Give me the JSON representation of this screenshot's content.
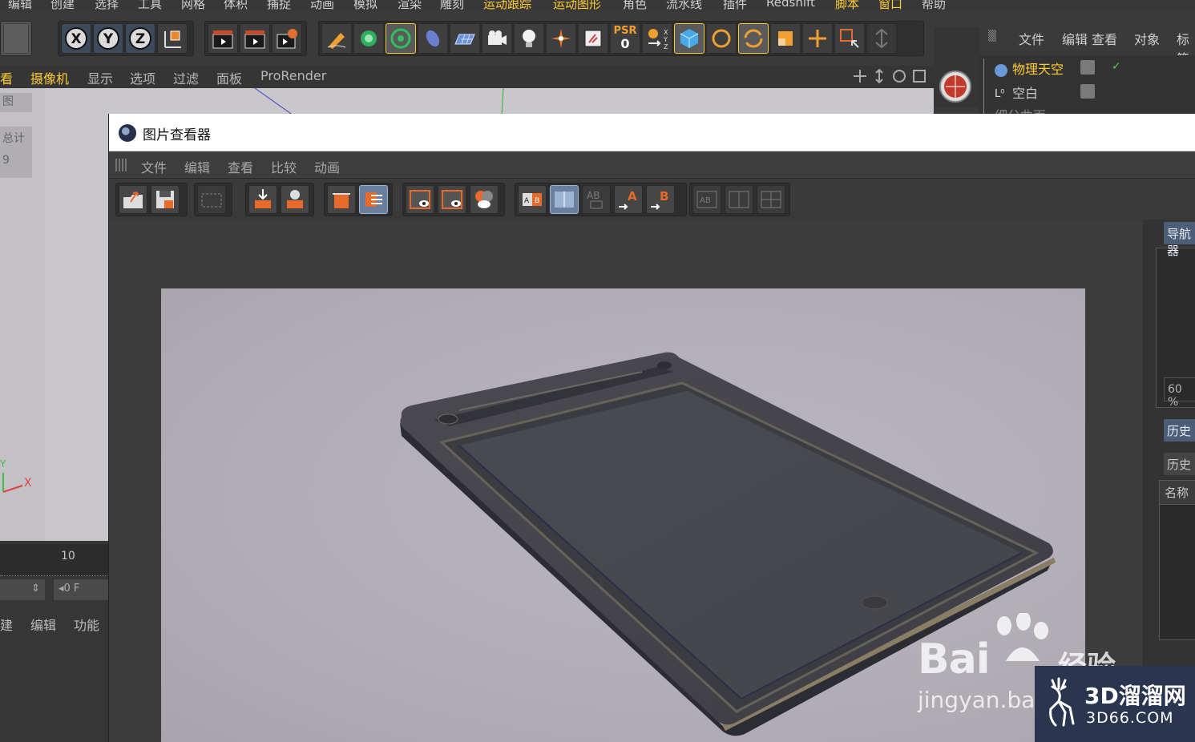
{
  "app": {
    "menu": [
      "编辑",
      "创建",
      "选择",
      "工具",
      "网格",
      "体积",
      "捕捉",
      "动画",
      "模拟",
      "渲染",
      "雕刻",
      "运动跟踪",
      "运动图形",
      "角色",
      "流水线",
      "插件",
      "Redshift",
      "脚本",
      "窗口",
      "帮助"
    ],
    "toolbar": {
      "psr_label": "PSR",
      "psr_value": "0"
    },
    "viewport_menu": [
      "看",
      "摄像机",
      "显示",
      "选项",
      "过滤",
      "面板",
      "ProRender"
    ],
    "left_labels": [
      "图",
      "总计",
      "9"
    ],
    "axes": {
      "x": "X",
      "y": "Y"
    }
  },
  "object_manager": {
    "menu": [
      "文件",
      "编辑",
      "查看",
      "对象",
      "标签"
    ],
    "objects": [
      {
        "name": "物理天空",
        "highlight": true
      },
      {
        "name": "空白",
        "highlight": false
      },
      {
        "name": "细分曲面",
        "highlight": false
      }
    ]
  },
  "timeline": {
    "frame_tick": "10",
    "frame_field": "0 F",
    "menu": [
      "建",
      "编辑",
      "功能"
    ]
  },
  "picture_viewer": {
    "title": "图片查看器",
    "menu": [
      "文件",
      "编辑",
      "查看",
      "比较",
      "动画"
    ],
    "side": {
      "nav_tab": "导航器",
      "zoom": "60 %",
      "history_tab": "历史",
      "history_sub": "历史",
      "name_col": "名称"
    }
  },
  "colors": {
    "accent_yellow": "#ffcc33",
    "viewer_tab_blue": "#4b5d77",
    "render_bg": "#b2acb4",
    "tablet_body": "#444449"
  },
  "watermarks": {
    "baidu": "Bai",
    "baidu_cn": "经验",
    "baidu_url": "jingyan.ba",
    "site_cn": "3D溜溜网",
    "site_url": "3D66.COM"
  }
}
